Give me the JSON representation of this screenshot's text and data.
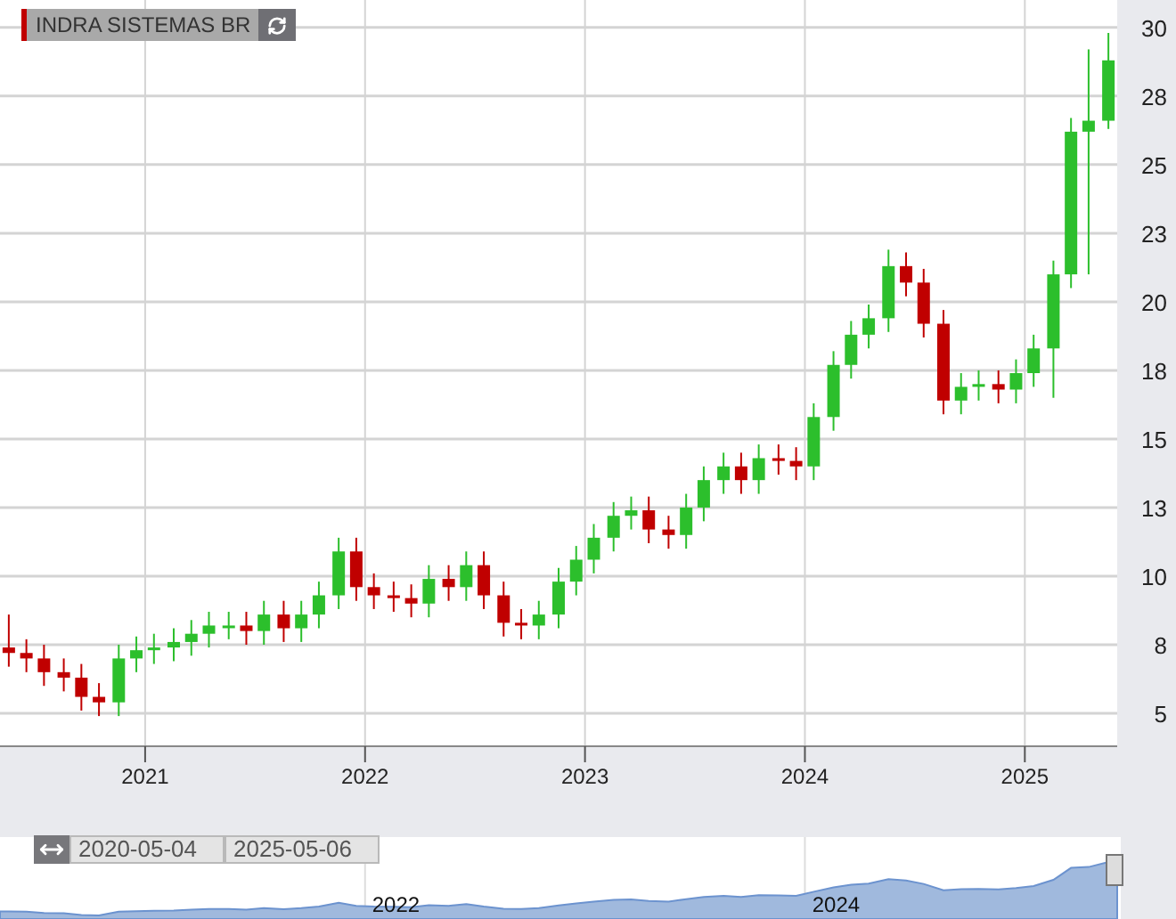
{
  "chart_data": {
    "type": "candlestick",
    "title": "INDRA SISTEMAS BR",
    "x": [
      2020.38,
      2020.46,
      2020.54,
      2020.63,
      2020.71,
      2020.79,
      2020.88,
      2020.96,
      2021.04,
      2021.13,
      2021.21,
      2021.29,
      2021.38,
      2021.46,
      2021.54,
      2021.63,
      2021.71,
      2021.79,
      2021.88,
      2021.96,
      2022.04,
      2022.13,
      2022.21,
      2022.29,
      2022.38,
      2022.46,
      2022.54,
      2022.63,
      2022.71,
      2022.79,
      2022.88,
      2022.96,
      2023.04,
      2023.13,
      2023.21,
      2023.29,
      2023.38,
      2023.46,
      2023.54,
      2023.63,
      2023.71,
      2023.79,
      2023.88,
      2023.96,
      2024.04,
      2024.13,
      2024.21,
      2024.29,
      2024.38,
      2024.46,
      2024.54,
      2024.63,
      2024.71,
      2024.79,
      2024.88,
      2024.96,
      2025.04,
      2025.13,
      2025.21,
      2025.29,
      2025.38
    ],
    "ohlc": [
      [
        7.4,
        8.6,
        6.7,
        7.2
      ],
      [
        7.2,
        7.7,
        6.5,
        7.0
      ],
      [
        7.0,
        7.5,
        6.0,
        6.5
      ],
      [
        6.5,
        7.0,
        5.8,
        6.3
      ],
      [
        6.3,
        6.8,
        5.1,
        5.6
      ],
      [
        5.6,
        6.1,
        4.9,
        5.4
      ],
      [
        5.4,
        7.5,
        4.9,
        7.0
      ],
      [
        7.0,
        7.8,
        6.5,
        7.3
      ],
      [
        7.3,
        7.9,
        6.8,
        7.4
      ],
      [
        7.4,
        8.1,
        6.9,
        7.6
      ],
      [
        7.6,
        8.4,
        7.1,
        7.9
      ],
      [
        7.9,
        8.7,
        7.4,
        8.2
      ],
      [
        8.2,
        8.7,
        7.7,
        8.2
      ],
      [
        8.2,
        8.7,
        7.5,
        8.0
      ],
      [
        8.0,
        9.1,
        7.5,
        8.6
      ],
      [
        8.6,
        9.1,
        7.6,
        8.1
      ],
      [
        8.1,
        9.1,
        7.6,
        8.6
      ],
      [
        8.6,
        9.8,
        8.1,
        9.3
      ],
      [
        9.3,
        11.4,
        8.8,
        10.9
      ],
      [
        10.9,
        11.4,
        9.1,
        9.6
      ],
      [
        9.6,
        10.1,
        8.8,
        9.3
      ],
      [
        9.3,
        9.8,
        8.7,
        9.2
      ],
      [
        9.2,
        9.7,
        8.5,
        9.0
      ],
      [
        9.0,
        10.4,
        8.5,
        9.9
      ],
      [
        9.9,
        10.4,
        9.1,
        9.6
      ],
      [
        9.6,
        10.9,
        9.1,
        10.4
      ],
      [
        10.4,
        10.9,
        8.8,
        9.3
      ],
      [
        9.3,
        9.8,
        7.8,
        8.3
      ],
      [
        8.3,
        8.8,
        7.7,
        8.2
      ],
      [
        8.2,
        9.1,
        7.7,
        8.6
      ],
      [
        8.6,
        10.3,
        8.1,
        9.8
      ],
      [
        9.8,
        11.1,
        9.3,
        10.6
      ],
      [
        10.6,
        11.9,
        10.1,
        11.4
      ],
      [
        11.4,
        12.7,
        10.9,
        12.2
      ],
      [
        12.2,
        12.9,
        11.7,
        12.4
      ],
      [
        12.4,
        12.9,
        11.2,
        11.7
      ],
      [
        11.7,
        12.2,
        11.0,
        11.5
      ],
      [
        11.5,
        13.0,
        11.0,
        12.5
      ],
      [
        12.5,
        14.0,
        12.0,
        13.5
      ],
      [
        13.5,
        14.5,
        13.0,
        14.0
      ],
      [
        14.0,
        14.5,
        13.0,
        13.5
      ],
      [
        13.5,
        14.8,
        13.0,
        14.3
      ],
      [
        14.3,
        14.8,
        13.7,
        14.2
      ],
      [
        14.2,
        14.7,
        13.5,
        14.0
      ],
      [
        14.0,
        16.3,
        13.5,
        15.8
      ],
      [
        15.8,
        18.2,
        15.3,
        17.7
      ],
      [
        17.7,
        19.3,
        17.2,
        18.8
      ],
      [
        18.8,
        19.9,
        18.3,
        19.4
      ],
      [
        19.4,
        21.9,
        18.9,
        21.3
      ],
      [
        21.3,
        21.8,
        20.2,
        20.7
      ],
      [
        20.7,
        21.2,
        18.7,
        19.2
      ],
      [
        19.2,
        19.7,
        15.9,
        16.4
      ],
      [
        16.4,
        17.4,
        15.9,
        16.9
      ],
      [
        16.9,
        17.5,
        16.4,
        17.0
      ],
      [
        17.0,
        17.5,
        16.3,
        16.8
      ],
      [
        16.8,
        17.9,
        16.3,
        17.4
      ],
      [
        17.4,
        18.8,
        16.9,
        18.3
      ],
      [
        18.3,
        21.5,
        16.5,
        21.0
      ],
      [
        21.0,
        26.7,
        20.5,
        26.2
      ],
      [
        26.2,
        29.2,
        21.0,
        26.6
      ],
      [
        26.6,
        29.8,
        26.3,
        28.8
      ]
    ],
    "xticks": [
      2021,
      2022,
      2023,
      2024,
      2025
    ],
    "yticks": [
      {
        "value": 5,
        "label": "5"
      },
      {
        "value": 7.5,
        "label": "8"
      },
      {
        "value": 10,
        "label": "10"
      },
      {
        "value": 12.5,
        "label": "13"
      },
      {
        "value": 15,
        "label": "15"
      },
      {
        "value": 17.5,
        "label": "18"
      },
      {
        "value": 20,
        "label": "20"
      },
      {
        "value": 22.5,
        "label": "23"
      },
      {
        "value": 25,
        "label": "25"
      },
      {
        "value": 27.5,
        "label": "28"
      },
      {
        "value": 30,
        "label": "30"
      }
    ],
    "xlim": [
      2020.34,
      2025.42
    ],
    "ylim": [
      3.8,
      31
    ],
    "grid": true
  },
  "navigator": {
    "from": "2020-05-04",
    "to": "2025-05-06",
    "labels": [
      "2022",
      "2024"
    ]
  }
}
